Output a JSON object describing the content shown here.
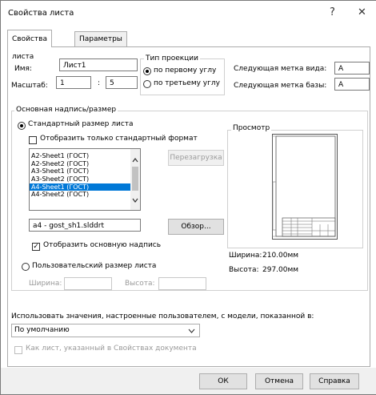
{
  "window": {
    "title": "Свойства листа",
    "help_glyph": "?",
    "close_glyph": "✕"
  },
  "tabs": [
    {
      "label": "Свойства листа"
    },
    {
      "label": "Параметры зоны"
    }
  ],
  "sheet": {
    "name_label": "Имя:",
    "name_value": "Лист1",
    "scale_label": "Масштаб:",
    "scale_num": "1",
    "scale_sep": ":",
    "scale_den": "5"
  },
  "projection": {
    "title": "Тип проекции",
    "options": [
      {
        "label": "по первому углу",
        "selected": true
      },
      {
        "label": "по третьему углу",
        "selected": false
      }
    ]
  },
  "labels": {
    "next_view_label": "Следующая метка вида:",
    "next_view_value": "A",
    "next_datum_label": "Следующая метка базы:",
    "next_datum_value": "A"
  },
  "format": {
    "group_title": "Основная надпись/размер",
    "standard_radio": "Стандартный размер листа",
    "only_standard_chk": "Отобразить только стандартный формат",
    "list": [
      "A2-Sheet1 (ГОСТ)",
      "A2-Sheet2 (ГОСТ)",
      "A3-Sheet1 (ГОСТ)",
      "A3-Sheet2 (ГОСТ)",
      "A4-Sheet1 (ГОСТ)",
      "A4-Sheet2 (ГОСТ)"
    ],
    "selected_index": 4,
    "reload_button": "Перезагрузка",
    "file_value": "a4 - gost_sh1.slddrt",
    "browse_button": "Обзор...",
    "show_title_chk": "Отобразить основную надпись",
    "custom_radio": "Пользовательский размер листа",
    "width_label": "Ширина:",
    "height_label": "Высота:"
  },
  "preview": {
    "title": "Просмотр",
    "width_label": "Ширина:",
    "width_value": "210.00мм",
    "height_label": "Высота:",
    "height_value": "297.00мм"
  },
  "model": {
    "label": "Использовать значения, настроенные пользователем, с модели, показанной в:",
    "combo_value": "По умолчанию",
    "doc_props_chk": "Как лист, указанный в Свойствах документа"
  },
  "footer": {
    "ok": "ОК",
    "cancel": "Отмена",
    "help": "Справка"
  }
}
